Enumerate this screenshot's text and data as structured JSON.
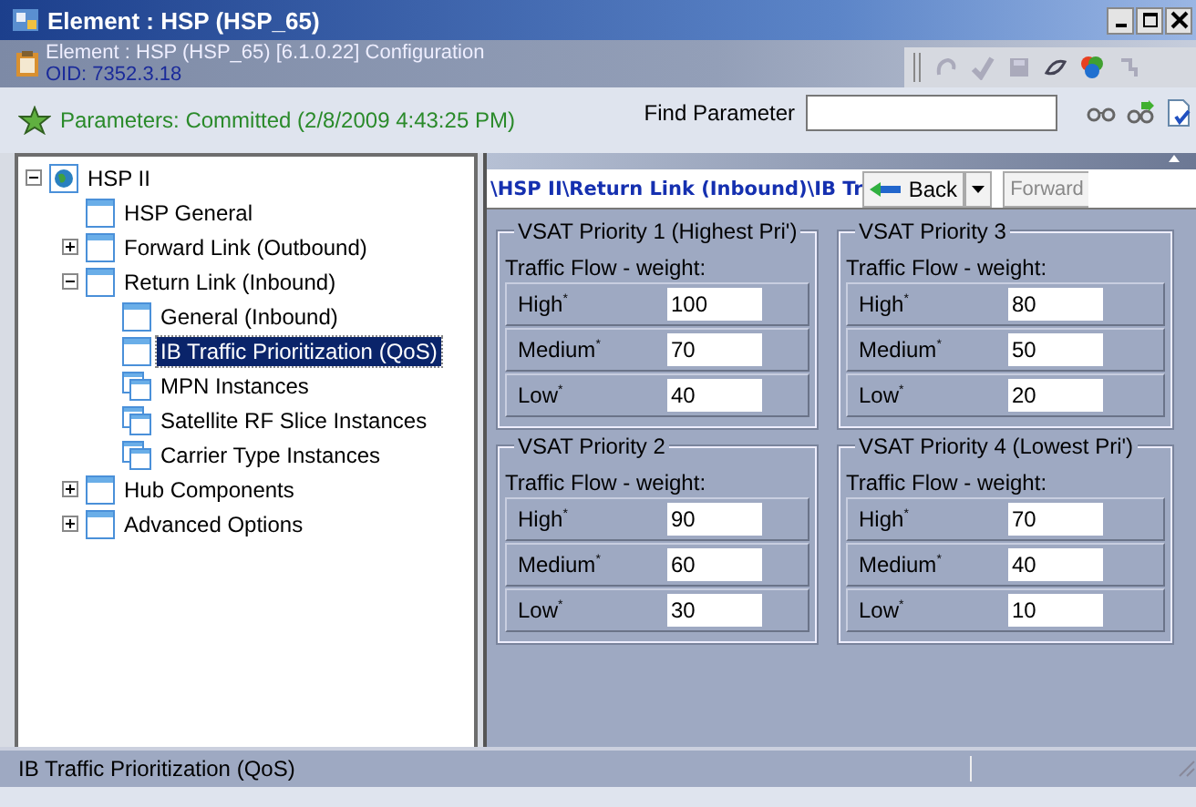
{
  "window": {
    "title": "Element : HSP (HSP_65)"
  },
  "header": {
    "title": "Element : HSP (HSP_65) [6.1.0.22] Configuration",
    "oid": "OID: 7352.3.18"
  },
  "status_line": {
    "text": "Parameters: Committed (2/8/2009 4:43:25 PM)"
  },
  "find": {
    "label": "Find Parameter"
  },
  "tree": [
    {
      "label": "HSP II",
      "expanded": true,
      "selected": false,
      "children": [
        {
          "label": "HSP General",
          "selected": false
        },
        {
          "label": "Forward Link (Outbound)",
          "expanded": false,
          "selected": false
        },
        {
          "label": "Return Link (Inbound)",
          "expanded": true,
          "selected": false,
          "children": [
            {
              "label": "General (Inbound)",
              "selected": false
            },
            {
              "label": "IB Traffic Prioritization (QoS)",
              "selected": true
            },
            {
              "label": "MPN Instances",
              "selected": false
            },
            {
              "label": "Satellite RF Slice Instances",
              "selected": false
            },
            {
              "label": "Carrier Type Instances",
              "selected": false
            }
          ]
        },
        {
          "label": "Hub Components",
          "expanded": false,
          "selected": false
        },
        {
          "label": "Advanced Options",
          "expanded": false,
          "selected": false
        }
      ]
    }
  ],
  "breadcrumb": "\\HSP II\\Return Link (Inbound)\\IB Tr",
  "nav": {
    "back": "Back",
    "forward": "Forward"
  },
  "groups": [
    {
      "title": "VSAT Priority 1 (Highest Pri')",
      "subtitle": "Traffic Flow - weight:",
      "rows": [
        {
          "label": "High$^{*}$",
          "value": "100"
        },
        {
          "label": "Medium$^{*}$",
          "value": "70"
        },
        {
          "label": "Low$^{*}$",
          "value": "40"
        }
      ]
    },
    {
      "title": "VSAT Priority 3",
      "subtitle": "Traffic Flow - weight:",
      "rows": [
        {
          "label": "High$^{*}$",
          "value": "80"
        },
        {
          "label": "Medium$^{*}$",
          "value": "50"
        },
        {
          "label": "Low$^{*}$",
          "value": "20"
        }
      ]
    },
    {
      "title": "VSAT Priority 2",
      "subtitle": "Traffic Flow - weight:",
      "rows": [
        {
          "label": "High$^{*}$",
          "value": "90"
        },
        {
          "label": "Medium$^{*}$",
          "value": "60"
        },
        {
          "label": "Low$^{*}$",
          "value": "30"
        }
      ]
    },
    {
      "title": "VSAT Priority 4 (Lowest Pri')",
      "subtitle": "Traffic Flow - weight:",
      "rows": [
        {
          "label": "High$^{*}$",
          "value": "70"
        },
        {
          "label": "Medium$^{*}$",
          "value": "40"
        },
        {
          "label": "Low$^{*}$",
          "value": "10"
        }
      ]
    }
  ],
  "status_bar": {
    "text": "IB Traffic Prioritization (QoS)"
  }
}
